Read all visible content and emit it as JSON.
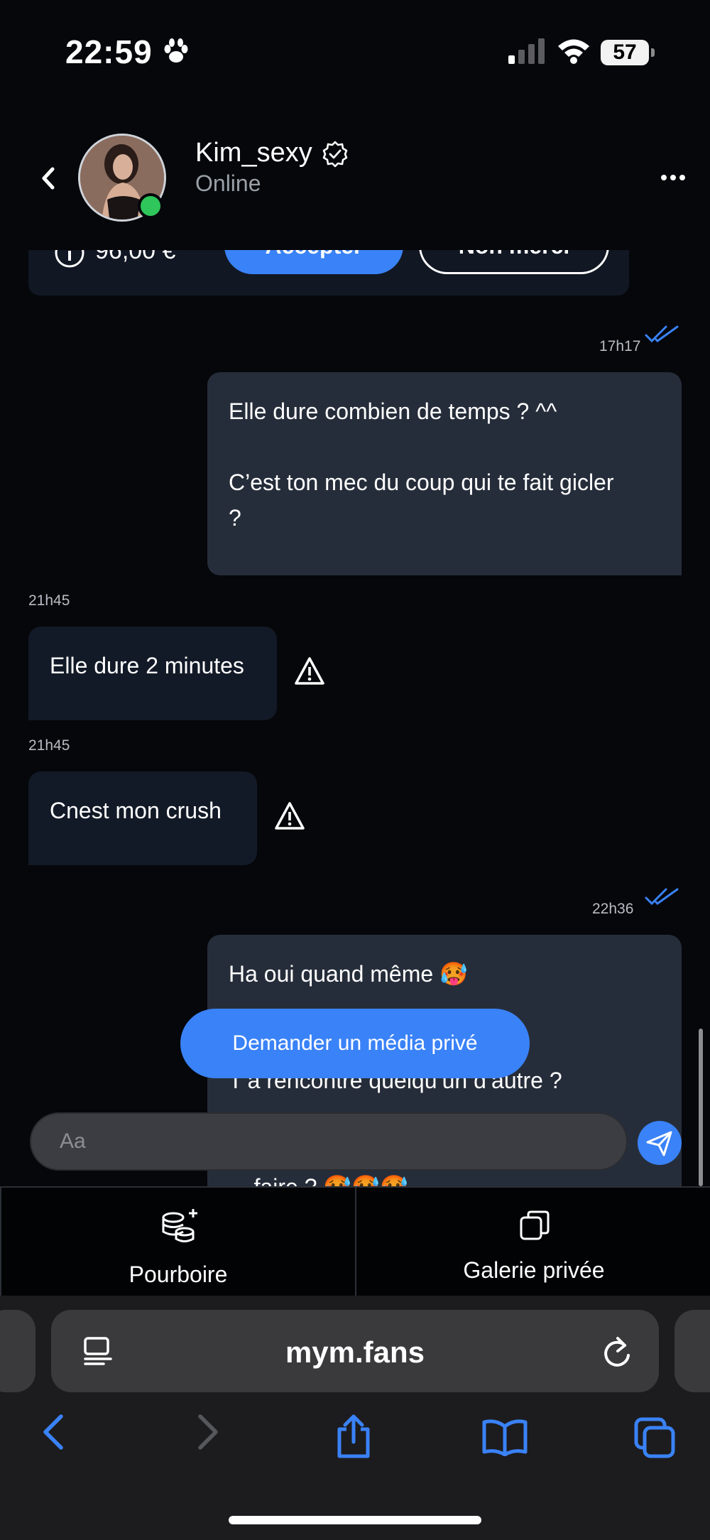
{
  "status_bar": {
    "time": "22:59",
    "battery": "57"
  },
  "header": {
    "name": "Kim_sexy",
    "status": "Online"
  },
  "offer": {
    "price": "96,00 €",
    "accept_label": "Accepter",
    "refuse_label": "Non merci"
  },
  "messages": [
    {
      "direction": "out",
      "time": "17h17",
      "text": "Elle dure combien de temps ? ^^\n\nC’est ton mec du coup qui te fait gicler\n?"
    },
    {
      "direction": "in",
      "time": "21h45",
      "text": "Elle dure 2 minutes"
    },
    {
      "direction": "in",
      "time": "21h45",
      "text": "Cnest mon crush"
    },
    {
      "direction": "out",
      "time": "22h36",
      "text": "Ha oui quand même 🥵\n\nt ton mec ?\nT’a rencontré quelqu’un d’autre ?\n\n en\n    faire ? 🥵🥵🥵"
    }
  ],
  "media_request_label": "Demander un média privé",
  "composer": {
    "placeholder": "Aa"
  },
  "tabs": {
    "tip_label": "Pourboire",
    "gallery_label": "Galerie privée"
  },
  "browser": {
    "url": "mym.fans"
  },
  "colors": {
    "accent": "#3a82f7",
    "background": "#05070a",
    "out_bubble": "#262d3a",
    "in_bubble": "#131a27",
    "online": "#2fc65b"
  }
}
